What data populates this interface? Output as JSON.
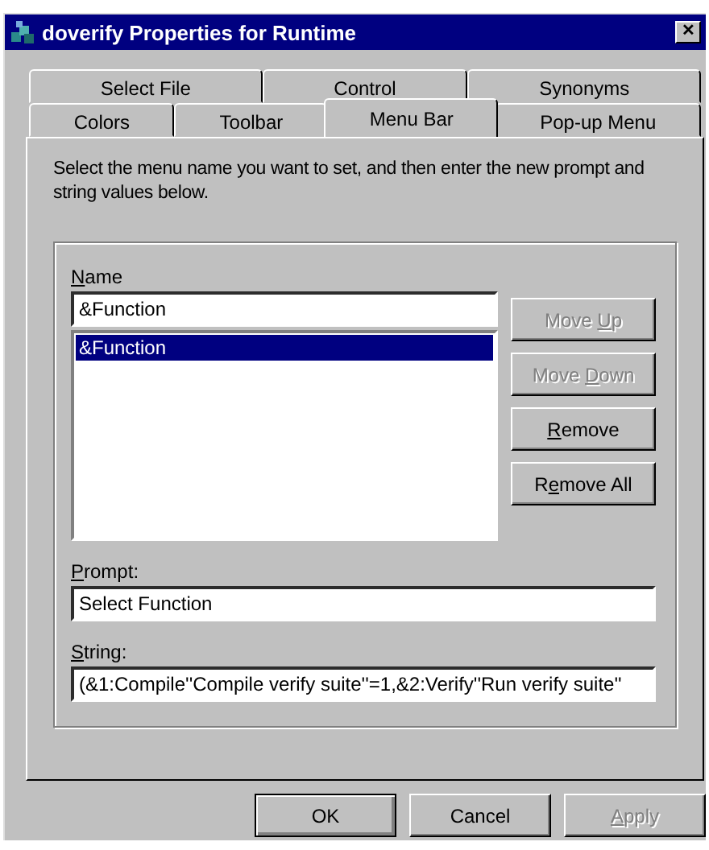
{
  "window": {
    "title": "doverify Properties for Runtime",
    "close": "✕"
  },
  "tab_rows": [
    {
      "tabs": [
        {
          "label": "Select File",
          "selected": false
        },
        {
          "label": "Control",
          "selected": false
        },
        {
          "label": "Synonyms",
          "selected": false
        }
      ]
    },
    {
      "tabs": [
        {
          "label": "Colors",
          "selected": false
        },
        {
          "label": "Toolbar",
          "selected": false
        },
        {
          "label": "Menu Bar",
          "selected": true
        },
        {
          "label": "Pop-up Menu",
          "selected": false
        }
      ]
    }
  ],
  "instructions": "Select the menu name you want to set, and then enter the new prompt and string values below.",
  "name": {
    "label": {
      "key": "N",
      "after": "ame"
    },
    "value": "&Function"
  },
  "list": [
    {
      "text": "&Function",
      "selected": true
    }
  ],
  "list_buttons": [
    {
      "label": {
        "before": "Move ",
        "key": "U",
        "after": "p"
      },
      "disabled": true
    },
    {
      "label": {
        "before": "Move ",
        "key": "D",
        "after": "own"
      },
      "disabled": true
    },
    {
      "label": {
        "key": "R",
        "after": "emove"
      },
      "disabled": false
    },
    {
      "label": {
        "before": "R",
        "key": "e",
        "after": "move All"
      },
      "disabled": false
    }
  ],
  "prompt": {
    "label": {
      "key": "P",
      "after": "rompt:"
    },
    "value": "Select Function"
  },
  "string": {
    "label": {
      "key": "S",
      "after": "tring:"
    },
    "value": "(&1:Compile''Compile verify suite''=1,&2:Verify''Run verify suite''"
  },
  "dialog_buttons": [
    {
      "label": {
        "before": "OK"
      },
      "disabled": false,
      "default": true
    },
    {
      "label": {
        "before": "Cancel"
      },
      "disabled": false,
      "default": false
    },
    {
      "label": {
        "key": "A",
        "after": "pply"
      },
      "disabled": true,
      "default": false
    }
  ]
}
